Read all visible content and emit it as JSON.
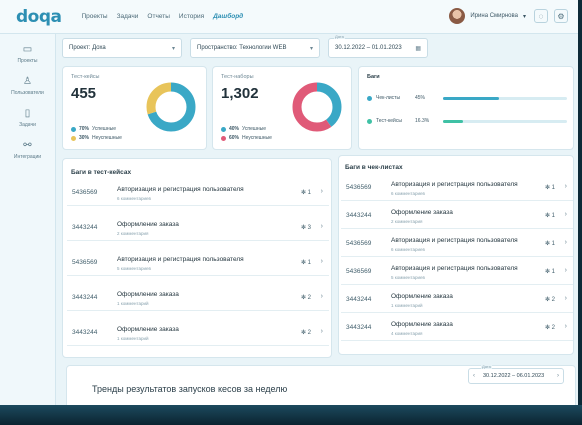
{
  "app": {
    "logo": "doqa"
  },
  "nav": [
    "Проекты",
    "Задачи",
    "Отчеты",
    "История",
    "Дашборд"
  ],
  "user": {
    "name": "Ирина Смирнова"
  },
  "sidebar": [
    "Проекты",
    "Пользователи",
    "Задачи",
    "Интеграции"
  ],
  "filters": {
    "project": "Проект: Доха",
    "space": "Пространство: Технологии WEB",
    "date_label": "Дата",
    "date": "30.12.2022 – 01.01.2023"
  },
  "cards": {
    "testcases": {
      "label": "Тест-кейсы",
      "value": "455",
      "legend": [
        {
          "pct": "70%",
          "text": "Успешные",
          "color": "#3aa8c6"
        },
        {
          "pct": "30%",
          "text": "Неуспешные",
          "color": "#e8c45a"
        }
      ],
      "donut": [
        0.7,
        0.3
      ]
    },
    "testruns": {
      "label": "Тест-наборы",
      "value": "1,302",
      "legend": [
        {
          "pct": "40%",
          "text": "Успешные",
          "color": "#3aa8c6"
        },
        {
          "pct": "60%",
          "text": "Неуспешные",
          "color": "#e05a78"
        }
      ],
      "donut": [
        0.4,
        0.6
      ]
    },
    "bugs": {
      "label": "Баги",
      "items": [
        {
          "name": "Чек-листы",
          "pct": "45%",
          "value": 0.45,
          "color": "#3aa8c6"
        },
        {
          "name": "Тест-кейсы",
          "pct": "16.3%",
          "value": 0.163,
          "color": "#3fc1a5"
        }
      ]
    }
  },
  "bugs_in_testcases": {
    "title": "Баги в тест-кейсах",
    "rows": [
      {
        "id": "5436569",
        "title": "Авторизация и регистрация пользователя",
        "sub": "6 комментариев",
        "bugs": "1"
      },
      {
        "id": "3443244",
        "title": "Оформление заказа",
        "sub": "2 комментария",
        "bugs": "3"
      },
      {
        "id": "5436569",
        "title": "Авторизация и регистрация пользователя",
        "sub": "5 комментариев",
        "bugs": "1"
      },
      {
        "id": "3443244",
        "title": "Оформление заказа",
        "sub": "1 комментарий",
        "bugs": "2"
      },
      {
        "id": "3443244",
        "title": "Оформление заказа",
        "sub": "1 комментарий",
        "bugs": "2"
      }
    ]
  },
  "bugs_in_checklists": {
    "title": "Баги в чек-листах",
    "rows": [
      {
        "id": "5436569",
        "title": "Авторизация и регистрация пользователя",
        "sub": "6 комментариев",
        "bugs": "1"
      },
      {
        "id": "3443244",
        "title": "Оформление заказа",
        "sub": "2 комментария",
        "bugs": "1"
      },
      {
        "id": "5436569",
        "title": "Авторизация и регистрация пользователя",
        "sub": "6 комментариев",
        "bugs": "1"
      },
      {
        "id": "5436569",
        "title": "Авторизация и регистрация пользователя",
        "sub": "5 комментариев",
        "bugs": "1"
      },
      {
        "id": "3443244",
        "title": "Оформление заказа",
        "sub": "1 комментарий",
        "bugs": "2"
      },
      {
        "id": "3443244",
        "title": "Оформление заказа",
        "sub": "4 комментария",
        "bugs": "2"
      }
    ]
  },
  "trends": {
    "title": "Тренды результатов запусков кесов за неделю",
    "date_label": "Дата",
    "date": "30.12.2022 – 06.01.2023"
  }
}
